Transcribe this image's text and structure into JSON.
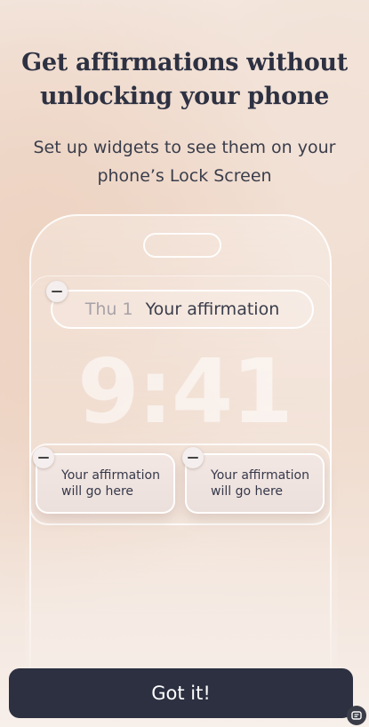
{
  "header": {
    "title_line1": "Get affirmations without",
    "title_line2": "unlocking your phone",
    "subtitle_line1": "Set up widgets to see them on your",
    "subtitle_line2": "phone’s Lock Screen"
  },
  "lockscreen": {
    "day": "Thu 1",
    "affirmation_label": "Your affirmation",
    "time": "9:41",
    "widgets": [
      {
        "line1": "Your affirmation",
        "line2": "will go here"
      },
      {
        "line1": "Your affirmation",
        "line2": "will go here"
      }
    ],
    "remove_icon": "minus-circle-icon"
  },
  "cta": {
    "label": "Got it!"
  },
  "colors": {
    "button_bg": "#2c3040",
    "text_dark": "#2d3142"
  },
  "floating_icon": "assistant-icon"
}
